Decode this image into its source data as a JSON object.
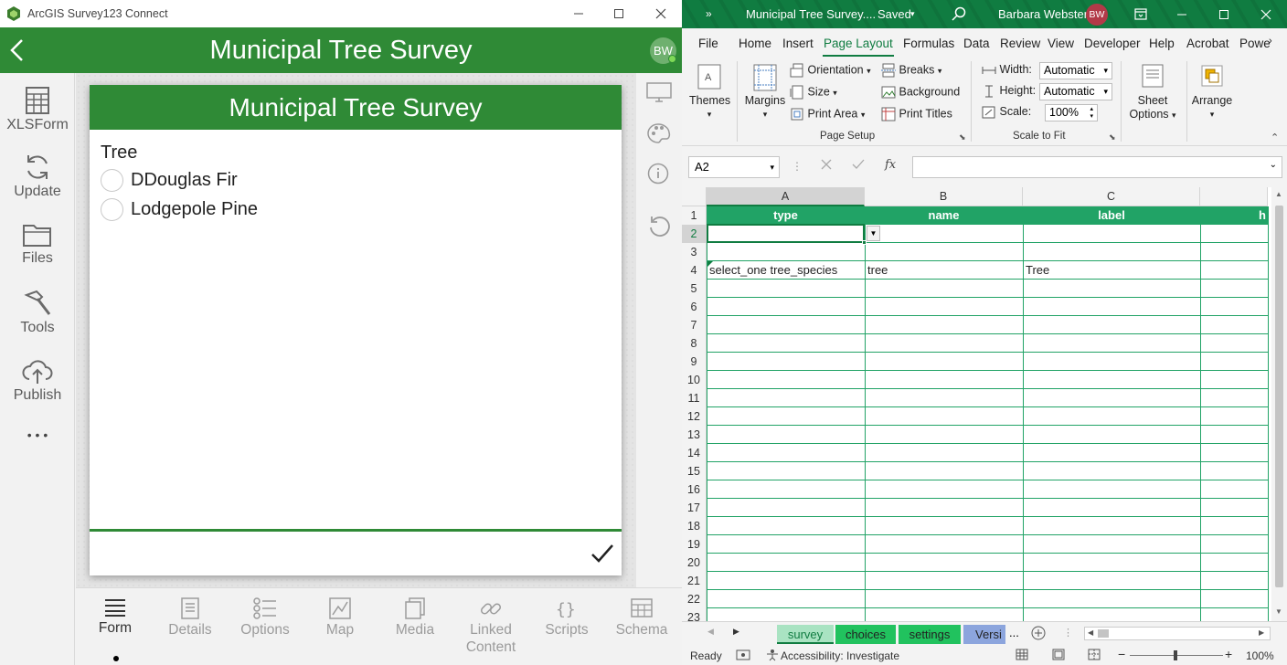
{
  "survey123": {
    "window_title": "ArcGIS Survey123 Connect",
    "header_title": "Municipal Tree Survey",
    "avatar": "BW",
    "nav": [
      "XLSForm",
      "Update",
      "Files",
      "Tools",
      "Publish"
    ],
    "more": "• • •",
    "form": {
      "title": "Municipal Tree Survey",
      "question": "Tree",
      "choices": [
        "DDouglas Fir",
        "Lodgepole Pine"
      ]
    },
    "bottom_tabs": {
      "form": "Form",
      "details": "Details",
      "options": "Options",
      "map": "Map",
      "media": "Media",
      "linked_line1": "Linked",
      "linked_line2": "Content",
      "scripts": "Scripts",
      "schema": "Schema"
    },
    "accent_color": "#2f8a36"
  },
  "excel": {
    "title": "Municipal Tree Survey....",
    "saved": "Saved",
    "user": "Barbara Webster",
    "avatar": "BW",
    "ribbon_tabs": [
      "File",
      "Home",
      "Insert",
      "Page Layout",
      "Formulas",
      "Data",
      "Review",
      "View",
      "Developer",
      "Help",
      "Acrobat",
      "Powe"
    ],
    "active_tab": "Page Layout",
    "ribbon": {
      "themes": "Themes",
      "margins": "Margins",
      "orientation": "Orientation",
      "size": "Size",
      "print_area": "Print Area",
      "breaks": "Breaks",
      "background": "Background",
      "print_titles": "Print Titles",
      "page_setup": "Page Setup",
      "width_label": "Width:",
      "width_value": "Automatic",
      "height_label": "Height:",
      "height_value": "Automatic",
      "scale_label": "Scale:",
      "scale_value": "100%",
      "scale_to_fit": "Scale to Fit",
      "sheet_options_1": "Sheet",
      "sheet_options_2": "Options",
      "arrange": "Arrange"
    },
    "name_box": "A2",
    "formula": "",
    "columns": [
      "A",
      "B",
      "C"
    ],
    "header_row": [
      "type",
      "name",
      "label",
      "h"
    ],
    "rows": [
      "1",
      "2",
      "3",
      "4",
      "5",
      "6",
      "7",
      "8",
      "9",
      "10",
      "11",
      "12",
      "13",
      "14",
      "15",
      "16",
      "17",
      "18",
      "19",
      "20",
      "21",
      "22",
      "23"
    ],
    "row4": [
      "select_one tree_species",
      "tree",
      "Tree"
    ],
    "sheets": [
      "survey",
      "choices",
      "settings",
      "Versi"
    ],
    "sheet_more": "...",
    "status": {
      "ready": "Ready",
      "accessibility": "Accessibility: Investigate",
      "zoom": "100%"
    },
    "accent_color": "#107c41"
  }
}
